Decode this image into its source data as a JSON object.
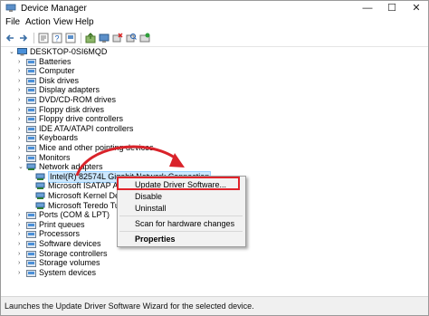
{
  "window": {
    "title": "Device Manager",
    "controls": [
      "—",
      "☐",
      "✕"
    ]
  },
  "menu": [
    "File",
    "Action",
    "View",
    "Help"
  ],
  "toolbar": [
    "back-icon",
    "forward-icon",
    "properties-icon",
    "help-icon",
    "update-driver-icon",
    "uninstall-icon",
    "scan-icon",
    "enable-icon"
  ],
  "tree": {
    "root": "DESKTOP-0SI6MQD",
    "categories": [
      "Batteries",
      "Computer",
      "Disk drives",
      "Display adapters",
      "DVD/CD-ROM drives",
      "Floppy disk drives",
      "Floppy drive controllers",
      "IDE ATA/ATAPI controllers",
      "Keyboards",
      "Mice and other pointing devices",
      "Monitors",
      "Network adapters"
    ],
    "network_children": [
      "Intel(R) 82574L Gigabit Network Connection",
      "Microsoft ISATAP Adapter",
      "Microsoft Kernel Debug",
      "Microsoft Teredo Tunnel"
    ],
    "categories_after": [
      "Ports (COM & LPT)",
      "Print queues",
      "Processors",
      "Software devices",
      "Storage controllers",
      "Storage volumes",
      "System devices"
    ]
  },
  "context_menu": {
    "items": [
      "Update Driver Software...",
      "Disable",
      "Uninstall",
      "Scan for hardware changes",
      "Properties"
    ]
  },
  "status_bar": "Launches the Update Driver Software Wizard for the selected device.",
  "colors": {
    "highlight": "#e0232a",
    "selection": "#cce8ff",
    "folder": "#e8c35a",
    "computer": "#4a90d9"
  }
}
